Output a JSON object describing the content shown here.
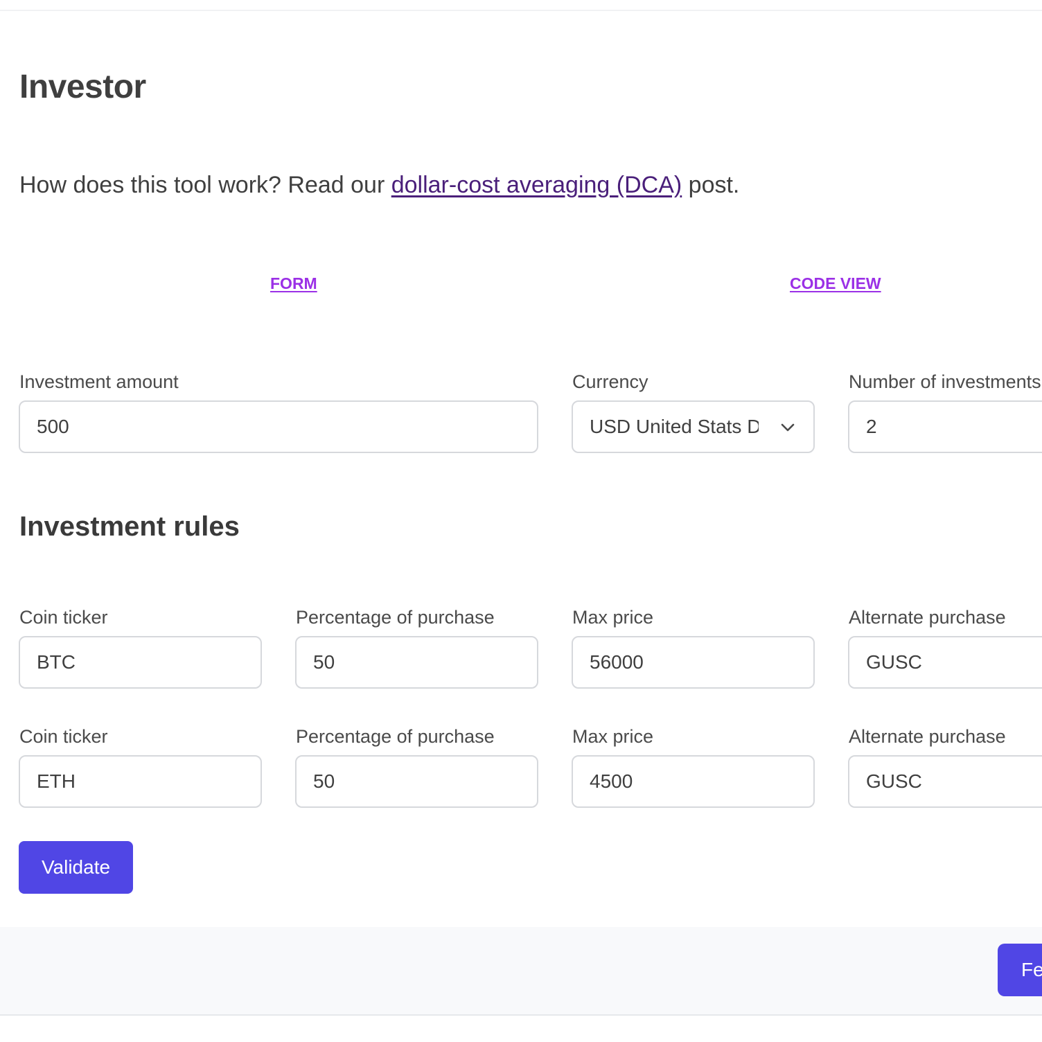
{
  "header": {
    "title": "Investor"
  },
  "intro": {
    "prefix": "How does this tool work? Read our ",
    "link_text": "dollar-cost averaging (DCA)",
    "suffix": " post."
  },
  "tabs": {
    "form_label": "FORM",
    "code_view_label": "CODE VIEW"
  },
  "settings": {
    "amount_label": "Investment amount",
    "amount_value": "500",
    "currency_label": "Currency",
    "currency_value": "USD United Stats Dollar",
    "count_label": "Number of investments",
    "count_value": "2"
  },
  "rules": {
    "title": "Investment rules",
    "items": [
      {
        "ticker_label": "Coin ticker",
        "ticker": "BTC",
        "percentage_label": "Percentage of purchase",
        "percentage": "50",
        "max_price_label": "Max price",
        "max_price": "56000",
        "alternate_label": "Alternate purchase",
        "alternate": "GUSC"
      },
      {
        "ticker_label": "Coin ticker",
        "ticker": "ETH",
        "percentage_label": "Percentage of purchase",
        "percentage": "50",
        "max_price_label": "Max price",
        "max_price": "4500",
        "alternate_label": "Alternate purchase",
        "alternate": "GUSC"
      }
    ]
  },
  "actions": {
    "validate_label": "Validate",
    "footer_button_label": "Fe"
  },
  "icons": {
    "currency_dropdown": "chevron-down-icon"
  },
  "colors": {
    "accent": "#5046e5",
    "tab_link": "#9b30e6",
    "intro_link": "#4a1f7a"
  }
}
